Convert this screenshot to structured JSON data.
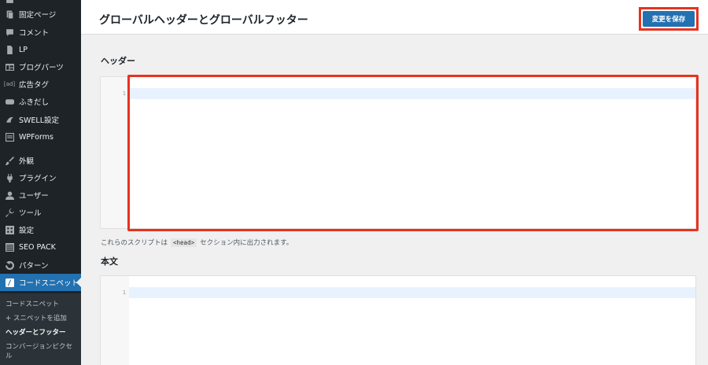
{
  "sidebar": {
    "items": [
      {
        "label": "固定ページ",
        "icon": "pages-icon"
      },
      {
        "label": "コメント",
        "icon": "comment-icon"
      },
      {
        "label": "LP",
        "icon": "page-icon"
      },
      {
        "label": "ブログパーツ",
        "icon": "parts-icon"
      },
      {
        "label": "広告タグ",
        "icon": "ad-icon"
      },
      {
        "label": "ふきだし",
        "icon": "speech-icon"
      },
      {
        "label": "SWELL設定",
        "icon": "swell-icon"
      },
      {
        "label": "WPForms",
        "icon": "form-icon"
      },
      {
        "label": "外観",
        "icon": "brush-icon"
      },
      {
        "label": "プラグイン",
        "icon": "plugin-icon"
      },
      {
        "label": "ユーザー",
        "icon": "user-icon"
      },
      {
        "label": "ツール",
        "icon": "wrench-icon"
      },
      {
        "label": "設定",
        "icon": "settings-icon"
      },
      {
        "label": "SEO PACK",
        "icon": "seo-icon"
      },
      {
        "label": "パターン",
        "icon": "pattern-icon"
      },
      {
        "label": "コードスニペット",
        "icon": "code-icon"
      }
    ],
    "submenu": [
      {
        "label": "コードスニペット"
      },
      {
        "label": "+ スニペットを追加"
      },
      {
        "label": "ヘッダーとフッター"
      },
      {
        "label": "コンバージョンピクセ"
      },
      {
        "label": "ル"
      }
    ]
  },
  "header": {
    "title": "グローバルヘッダーとグローバルフッター",
    "save_label": "変更を保存"
  },
  "main": {
    "header_section": {
      "label": "ヘッダー",
      "line_number": "1",
      "help_before": "これらのスクリプトは",
      "help_code": "<head>",
      "help_after": "セクション内に出力されます。"
    },
    "body_section": {
      "label": "本文",
      "line_number": "1"
    }
  },
  "colors": {
    "sidebar_bg": "#1d2327",
    "accent": "#2271b1",
    "highlight": "#e8321f"
  }
}
